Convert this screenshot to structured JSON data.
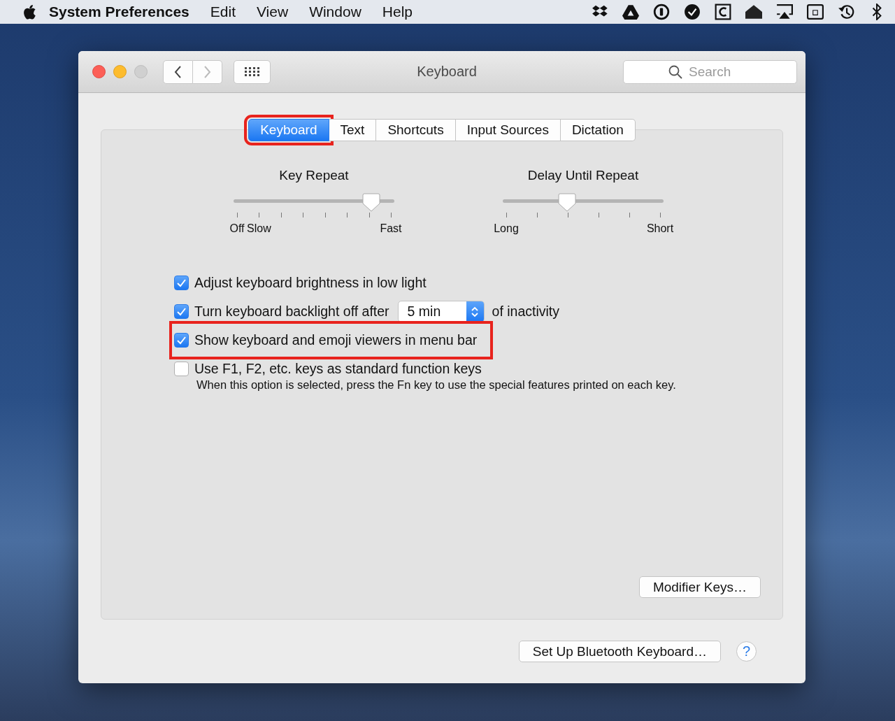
{
  "menu_bar": {
    "app_name": "System Preferences",
    "menus": [
      "Edit",
      "View",
      "Window",
      "Help"
    ]
  },
  "window": {
    "title": "Keyboard",
    "search": {
      "placeholder": "Search"
    },
    "tabs": [
      {
        "label": "Keyboard",
        "selected": true,
        "highlighted": true
      },
      {
        "label": "Text",
        "selected": false,
        "highlighted": false
      },
      {
        "label": "Shortcuts",
        "selected": false,
        "highlighted": false
      },
      {
        "label": "Input Sources",
        "selected": false,
        "highlighted": false
      },
      {
        "label": "Dictation",
        "selected": false,
        "highlighted": false
      }
    ],
    "sliders": [
      {
        "kind": "speed",
        "title": "Key Repeat",
        "level": 0.857,
        "labels": [
          "Off",
          "Slow",
          "Fast"
        ]
      },
      {
        "kind": "delay",
        "title": "Delay Until Repeat",
        "level": 0.4,
        "labels": [
          "Long",
          "Short"
        ]
      }
    ],
    "options": [
      {
        "kind": "plain",
        "label": "Adjust keyboard brightness in low light",
        "checked": true,
        "highlighted": false
      },
      {
        "kind": "popup",
        "label": "Turn keyboard backlight off after",
        "value": "5 min",
        "suffix": "of inactivity",
        "checked": true,
        "highlighted": false
      },
      {
        "kind": "plain",
        "label": "Show keyboard and emoji viewers in menu bar",
        "checked": true,
        "highlighted": true
      },
      {
        "kind": "plain",
        "label": "Use F1, F2, etc. keys as standard function keys",
        "note": "When this option is selected, press the Fn key to use the special features printed on each key.",
        "checked": false,
        "highlighted": false
      }
    ],
    "panel_button": "Modifier Keys…",
    "footer_button": "Set Up Bluetooth Keyboard…",
    "help_button": "?"
  }
}
